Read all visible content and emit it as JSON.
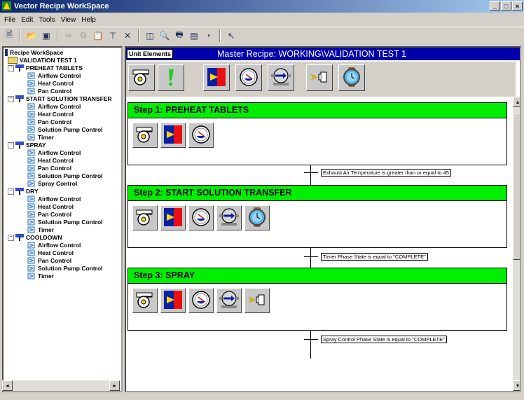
{
  "window": {
    "title": "Vector Recipe WorkSpace",
    "min_label": "_",
    "max_label": "□",
    "close_label": "×"
  },
  "menu": [
    "File",
    "Edit",
    "Tools",
    "View",
    "Help"
  ],
  "tree": {
    "root": "Recipe WorkSpace",
    "recipe": "VALIDATION TEST 1",
    "groups": [
      {
        "label": "PREHEAT TABLETS",
        "items": [
          "Airflow Control",
          "Heat Control",
          "Pan Control"
        ]
      },
      {
        "label": "START SOLUTION TRANSFER",
        "items": [
          "Airflow Control",
          "Heat Control",
          "Pan Control",
          "Solution Pump Control",
          "Timer"
        ]
      },
      {
        "label": "SPRAY",
        "items": [
          "Airflow Control",
          "Heat Control",
          "Pan Control",
          "Solution Pump Control",
          "Spray Control"
        ]
      },
      {
        "label": "DRY",
        "items": [
          "Airflow Control",
          "Heat Control",
          "Pan Control",
          "Solution Pump Control",
          "Timer"
        ]
      },
      {
        "label": "COOLDOWN",
        "items": [
          "Airflow Control",
          "Heat Control",
          "Pan Control",
          "Solution Pump Control",
          "Timer"
        ]
      }
    ]
  },
  "header": {
    "unit_elements": "Unit Elements",
    "master_title": "Master Recipe: WORKING\\VALIDATION TEST 1"
  },
  "palette": [
    "fan-icon",
    "exclamation-icon",
    "heat-icon",
    "pan-icon",
    "pump-icon",
    "spray-icon",
    "timer-icon"
  ],
  "steps": [
    {
      "label": "Step 1: PREHEAT TABLETS",
      "icons": [
        "fan-icon",
        "heat-icon",
        "pan-icon"
      ]
    },
    {
      "label": "Step 2: START SOLUTION TRANSFER",
      "icons": [
        "fan-icon",
        "heat-icon",
        "pan-icon",
        "pump-icon",
        "timer-icon"
      ]
    },
    {
      "label": "Step 3: SPRAY",
      "icons": [
        "fan-icon",
        "heat-icon",
        "pan-icon",
        "pump-icon",
        "spray-icon"
      ]
    }
  ],
  "transitions": [
    "Exhaust Air Temperature is greater than or equal to 45",
    "Timer Phase State is equal to \"COMPLETE\"",
    "Spray Control Phase State is equal to \"COMPLETE\""
  ]
}
